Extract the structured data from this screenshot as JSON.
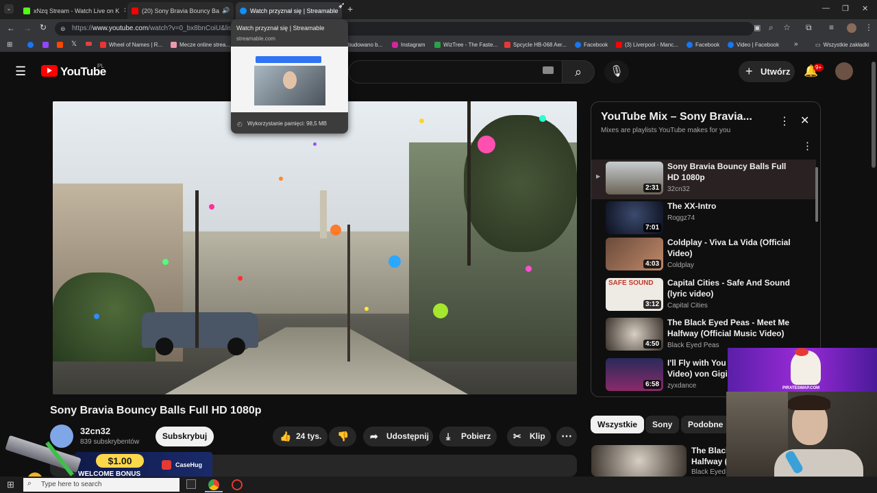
{
  "browser": {
    "tabs": [
      {
        "title": "xNzq Stream - Watch Live on K",
        "favicon_color": "#53fc18"
      },
      {
        "title": "(20) Sony Bravia Bouncy Ba",
        "favicon_color": "#ff0000"
      },
      {
        "title": "Watch przyznał się | Streamable",
        "favicon_color": "#0f90fa"
      }
    ],
    "url_prefix": "https://",
    "url_host": "www.youtube.com",
    "url_path": "/watch?v=0_bx8bnCoiU&list=",
    "bookmarks": [
      "Wheel of Names | R...",
      "Mecze online strea...",
      "budowano b...",
      "Instagram",
      "WizTree - The Faste...",
      "Spcycle HB-068 Aer...",
      "Facebook",
      "(3) Liverpool - Manc...",
      "Facebook",
      "Video | Facebook"
    ],
    "all_bookmarks": "Wszystkie zakładki",
    "tab_hover": {
      "title": "Watch przyznał się | Streamable",
      "domain": "streamable.com",
      "memory": "Wykorzystanie pamięci: 98,5 MB"
    }
  },
  "youtube": {
    "logo_text": "YouTube",
    "region": "PL",
    "create_label": "Utwórz",
    "notif_count": "9+",
    "video_title": "Sony Bravia Bouncy Balls Full HD 1080p",
    "channel": "32cn32",
    "subscribers": "839 subskrybentów",
    "subscribe_label": "Subskrybuj",
    "likes": "24 tys.",
    "share_label": "Udostępnij",
    "download_label": "Pobierz",
    "clip_label": "Klip",
    "playlist_title": "YouTube Mix – Sony Bravia...",
    "playlist_subtitle": "Mixes are playlists YouTube makes for you",
    "playlist": [
      {
        "title": "Sony Bravia Bouncy Balls Full HD 1080p",
        "channel": "32cn32",
        "duration": "2:31"
      },
      {
        "title": "The XX-Intro",
        "channel": "Roggz74",
        "duration": "7:01"
      },
      {
        "title": "Coldplay - Viva La Vida (Official Video)",
        "channel": "Coldplay",
        "duration": "4:03"
      },
      {
        "title": "Capital Cities - Safe And Sound (lyric video)",
        "channel": "Capital Cities",
        "duration": "3:12"
      },
      {
        "title": "The Black Eyed Peas - Meet Me Halfway (Official Music Video)",
        "channel": "Black Eyed Peas",
        "duration": "4:50"
      },
      {
        "title": "I'll Fly with You (C",
        "title2": "Video) von Gigi D",
        "channel": "zyxdance",
        "duration": "6:58"
      }
    ],
    "chips": [
      "Wszystkie",
      "Sony",
      "Podobne"
    ],
    "rec_title_1": "The Black",
    "rec_title_2": "Halfway (",
    "rec_channel": "Black Eyed"
  },
  "overlay": {
    "bonus_price": "$1.00",
    "bonus_text": "WELCOME BONUS",
    "brand": "CaseHug",
    "pirate_label": "PIRATESWAP.COM"
  },
  "taskbar": {
    "search_placeholder": "Type here to search"
  }
}
